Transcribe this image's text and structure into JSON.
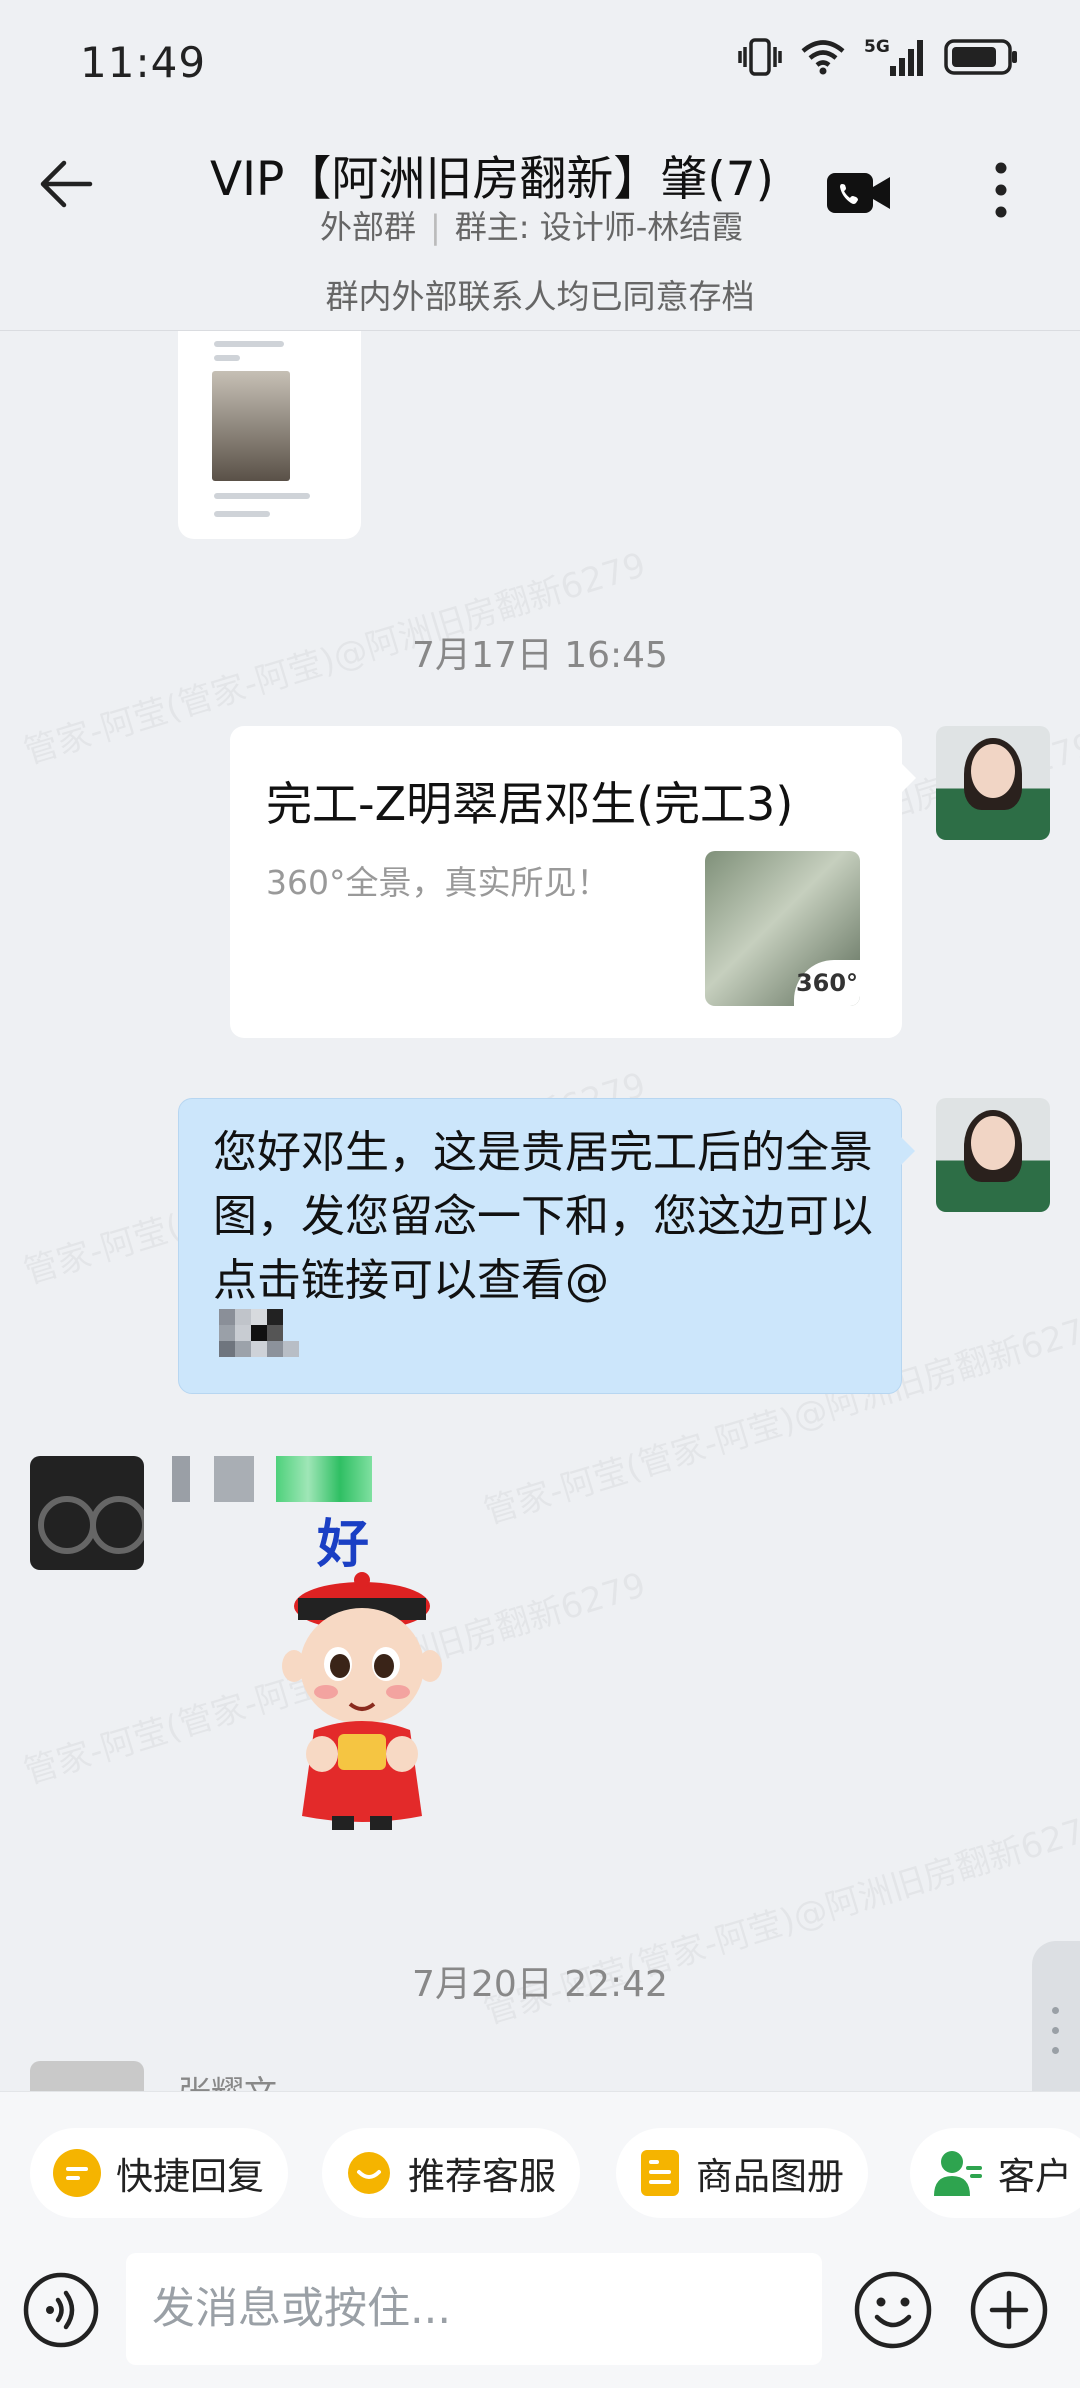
{
  "status_bar": {
    "time": "11:49",
    "network": "5G"
  },
  "header": {
    "title": "VIP【阿洲旧房翻新】肇(7)",
    "group_type": "外部群",
    "owner": "群主: 设计师-林结霞",
    "archive_notice": "群内外部联系人均已同意存档"
  },
  "chat": {
    "watermark": "管家-阿莹(管家-阿莹)@阿洲旧房翻新6279",
    "messages": [
      {
        "type": "timestamp",
        "text": "7月17日  16:45"
      },
      {
        "type": "link",
        "title": "完工-Z明翠居邓生(完工3)",
        "desc": "360°全景，真实所见！",
        "badge": "360°"
      },
      {
        "type": "text",
        "text": "您好邓生，这是贵居完工后的全景图，发您留念一下和，您这边可以点击链接可以查看@"
      },
      {
        "type": "sticker",
        "label": "好"
      },
      {
        "type": "timestamp",
        "text": "7月20日  22:42"
      },
      {
        "type": "sender",
        "name": "张耀文"
      }
    ]
  },
  "quick_actions": [
    {
      "label": "快捷回复",
      "icon": "quick-reply-icon",
      "color": "#f5b400"
    },
    {
      "label": "推荐客服",
      "icon": "recommend-service-icon",
      "color": "#f5b400"
    },
    {
      "label": "商品图册",
      "icon": "product-album-icon",
      "color": "#f5b400"
    },
    {
      "label": "客户",
      "icon": "customer-icon",
      "color": "#2ea44f"
    }
  ],
  "input": {
    "placeholder": "发消息或按住..."
  }
}
